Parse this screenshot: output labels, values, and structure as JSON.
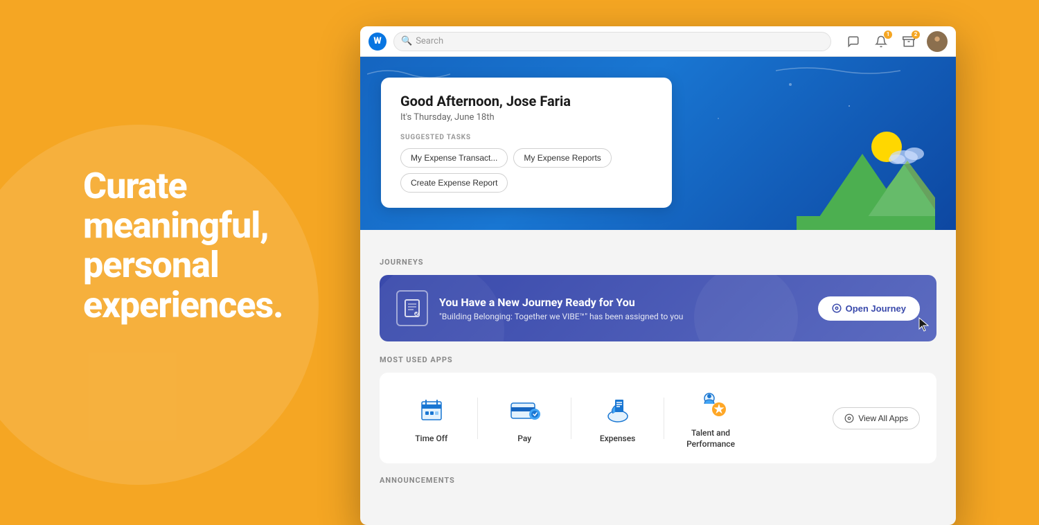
{
  "page": {
    "background_color": "#F5A623"
  },
  "left_section": {
    "tagline": "Curate meaningful, personal experiences."
  },
  "browser": {
    "logo_letter": "W",
    "search_placeholder": "Search",
    "icons": {
      "chat": "💬",
      "bell": "🔔",
      "inbox": "📥",
      "avatar_alt": "User avatar"
    }
  },
  "hero": {
    "greeting": "Good Afternoon, Jose Faria",
    "date": "It's Thursday, June 18th",
    "suggested_tasks_label": "SUGGESTED TASKS",
    "tasks": [
      {
        "label": "My Expense Transact..."
      },
      {
        "label": "My Expense Reports"
      },
      {
        "label": "Create Expense Report"
      }
    ]
  },
  "journeys": {
    "section_label": "JOURNEYS",
    "card": {
      "title": "You Have a New Journey Ready for You",
      "subtitle": "\"Building Belonging: Together we VIBE™\" has been assigned to you",
      "cta_label": "Open Journey"
    }
  },
  "most_used_apps": {
    "section_label": "MOST USED APPS",
    "apps": [
      {
        "id": "time-off",
        "label": "Time Off",
        "icon": "🗂️"
      },
      {
        "id": "pay",
        "label": "Pay",
        "icon": "💳"
      },
      {
        "id": "expenses",
        "label": "Expenses",
        "icon": "🧾"
      },
      {
        "id": "talent",
        "label": "Talent and\nPerformance",
        "icon": "👤"
      }
    ],
    "view_all_label": "View All Apps"
  },
  "announcements": {
    "section_label": "ANNOUNCEMENTS"
  }
}
